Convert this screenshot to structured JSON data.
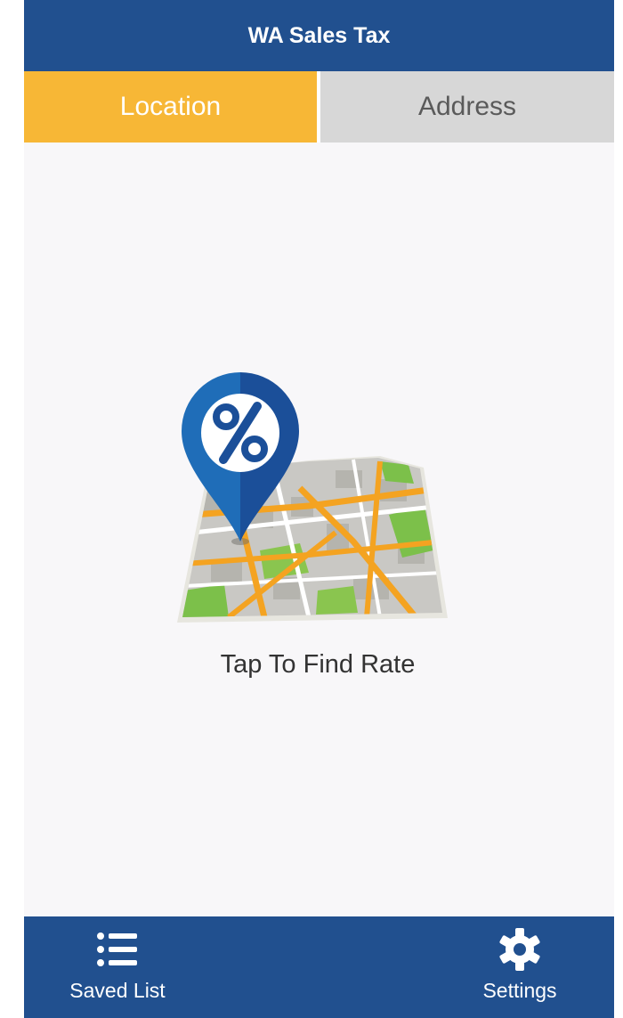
{
  "header": {
    "title": "WA Sales Tax"
  },
  "tabs": [
    {
      "label": "Location",
      "active": true
    },
    {
      "label": "Address",
      "active": false
    }
  ],
  "main": {
    "tap_label": "Tap To Find Rate",
    "pin_symbol": "%",
    "icon": "map-pin-percent-icon"
  },
  "bottom_nav": {
    "saved_list": {
      "label": "Saved List",
      "icon": "list-icon"
    },
    "settings": {
      "label": "Settings",
      "icon": "gear-icon"
    }
  },
  "colors": {
    "header_bg": "#21508f",
    "active_tab_bg": "#f7b736",
    "inactive_tab_bg": "#d7d7d7",
    "body_bg": "#f8f7f9",
    "pin_blue": "#1f5fa8"
  }
}
